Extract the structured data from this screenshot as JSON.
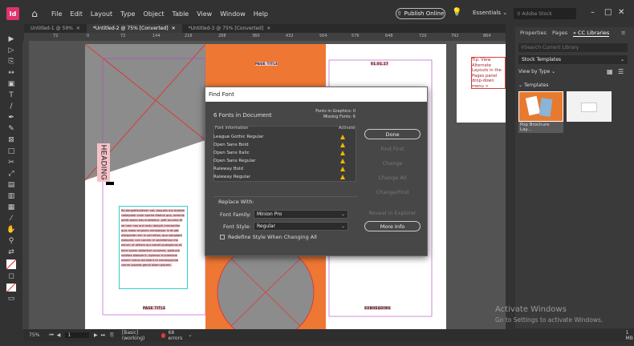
{
  "app": {
    "logo": "Id",
    "menu": [
      "File",
      "Edit",
      "Layout",
      "Type",
      "Object",
      "Table",
      "View",
      "Window",
      "Help"
    ],
    "publish_label": "Publish Online",
    "workspace": "Essentials",
    "search_placeholder": "Adobe Stock",
    "window_controls": [
      "–",
      "□",
      "✕"
    ]
  },
  "tabs": [
    {
      "label": "Untitled-1 @ 59%",
      "close": "✕",
      "active": false
    },
    {
      "label": "*Untitled-2 @ 75% [Converted]",
      "close": "✕",
      "active": true
    },
    {
      "label": "*Untitled-3 @ 75% [Converted]",
      "close": "✕",
      "active": false
    }
  ],
  "ruler": [
    "72",
    "0",
    "72",
    "144",
    "216",
    "288",
    "360",
    "432",
    "504",
    "576",
    "648",
    "720",
    "792",
    "864"
  ],
  "canvas": {
    "page_title_top": "PAGE TITLE",
    "date": "01.01.17",
    "heading": "HEADING",
    "page_title_bottom": "PAGE TITLE",
    "subheading": "SUBHEADING",
    "body_text": "Ro tempelfectatem nat, eaqueis ma ecatem ratlaqueai volor apicke ditatus quo, onsenis pedit apero eos endistatur, adit accullia fit ae nem nos aut rectu dolupti mincienthe quis molor erspium nimolorpor in et adt elotquiate rem in net elitas, qua voluptam esequist, con conem re sectetemus ma earum ut reliiam qui comet quiaspenus et facer ipiam dollectori conseres, quiducia nobitoe blabore it. Apienso truciemiam essimi nutius auriulant re consequunda comm ipsante gendi aliam plorem.",
    "side_text": "Tip: View Alternate Layouts in the Pages panel drop-down menu > Alternate Layout"
  },
  "dialog": {
    "title": "Find Font",
    "count": "6 Fonts in Document",
    "graphics": "Fonts in Graphics: 0",
    "missing": "Missing Fonts: 6",
    "col_info": "Font Information",
    "col_activate": "Activate",
    "fonts": [
      "League Gothic Regular",
      "Open Sans Bold",
      "Open Sans Italic",
      "Open Sans Regular",
      "Raleway Bold",
      "Raleway Regular"
    ],
    "buttons": {
      "done": "Done",
      "find_first": "Find First",
      "change": "Change",
      "change_all": "Change All",
      "change_find": "Change/Find",
      "reveal": "Reveal in Explorer",
      "more_info": "More Info"
    },
    "replace_with": "Replace With:",
    "family_label": "Font Family:",
    "family_value": "Minion Pro",
    "style_label": "Font Style:",
    "style_value": "Regular",
    "redefine_label": "Redefine Style When Changing All"
  },
  "panel": {
    "tabs": [
      "Properties",
      "Pages",
      "CC Libraries"
    ],
    "menu_icon": "≡",
    "search_placeholder": "Search Current Library",
    "library": "Stock Templates",
    "view_by": "View by Type",
    "section": "Templates",
    "thumb_caption": "Pop Brochure Lay...",
    "add": "+",
    "size": "1 MB"
  },
  "status": {
    "zoom": "75%",
    "page": "1",
    "preflight_profile": "[Basic] (working)",
    "errors": "68 errors"
  },
  "watermark": {
    "line1": "Activate Windows",
    "line2": "Go to Settings to activate Windows."
  },
  "colors": {
    "accent_orange": "#ee7733",
    "frame_red": "#d83b3b",
    "text_frame_cyan": "#33cccc",
    "page_margin_magenta": "#b044c8",
    "warn_yellow": "#f5b800"
  }
}
